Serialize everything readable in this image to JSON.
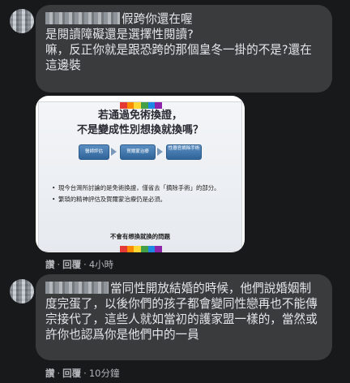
{
  "comments": [
    {
      "text": "假跨你還在喔\n是閱讀障礙還是選擇性閱讀?\n嘛，反正你就是跟恐跨的那個皇冬一掛的不是?還在這邊裝",
      "attachment": {
        "title_line1": "若通過免術換證，",
        "title_line2": "不是變成性別想換就換嗎？",
        "flow_steps": [
          "醫師評估",
          "賀爾蒙治療",
          "性器官摘除手術"
        ],
        "bullets": [
          "現今台灣所討論的是免術換證，僅省去「摘除手術」的部分。",
          "繁瑣的精神評估及賀爾蒙治療仍是必須。"
        ],
        "caption": "不會有想換就換的問題",
        "rainbow_colors": [
          "#e53935",
          "#fb8c00",
          "#fdd835",
          "#43a047",
          "#1e88e5",
          "#8e24aa"
        ]
      },
      "actions": {
        "like": "讚",
        "reply": "回覆",
        "separator": "·",
        "time": "4小時"
      }
    },
    {
      "text": "當同性開放結婚的時候，他們說婚姻制度完蛋了，以後你們的孩子都會變同性戀再也不能傳宗接代了，這些人就如當初的護家盟一樣的，當然或許你也認爲你是他們中的一員",
      "actions": {
        "like": "讚",
        "reply": "回覆",
        "separator": "·",
        "time": "10分鐘"
      }
    }
  ]
}
